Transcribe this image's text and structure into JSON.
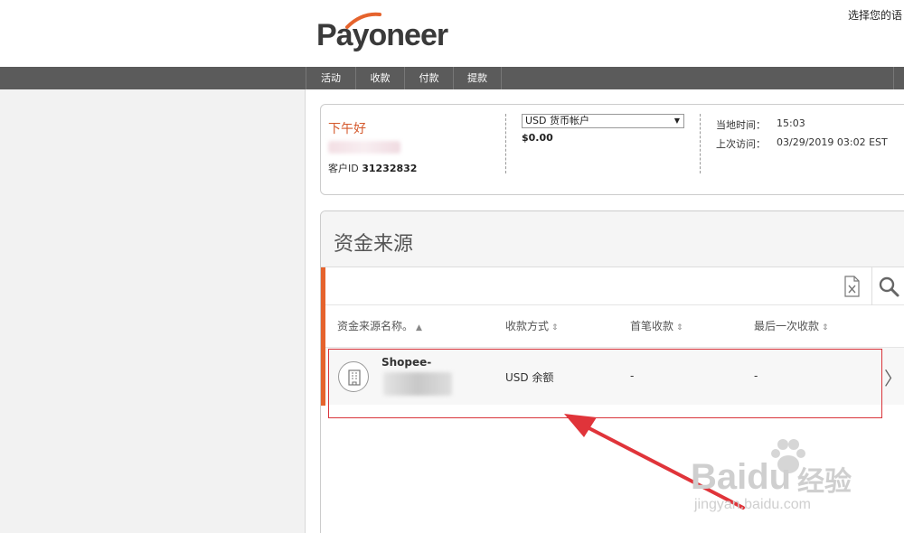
{
  "brand": {
    "logo_text": "Payoneer",
    "logo_accent": "#e5632d"
  },
  "header": {
    "language_link": "选择您的语"
  },
  "nav": {
    "items": [
      {
        "label": "活动"
      },
      {
        "label": "收款"
      },
      {
        "label": "付款"
      },
      {
        "label": "提款"
      }
    ]
  },
  "summary": {
    "greeting": "下午好",
    "customer_id_label": "客户ID",
    "customer_id": "31232832",
    "account_select": "USD 货币帐户",
    "balance": "$0.00",
    "local_time_label": "当地时间：",
    "local_time": "15:03",
    "last_visit_label": "上次访问：",
    "last_visit": "03/29/2019 03:02 EST"
  },
  "funding": {
    "title": "资金来源",
    "columns": [
      "资金来源名称。",
      "收款方式",
      "首笔收款",
      "最后一次收款"
    ],
    "rows": [
      {
        "name": "Shopee-",
        "method": "USD 余额",
        "first": "-",
        "last": "-"
      }
    ]
  },
  "watermark": {
    "brand": "Baidu",
    "suffix": "经验",
    "url": "jingyan.baidu.com"
  },
  "colors": {
    "accent": "#e5632d",
    "nav_bg": "#5b5b5b",
    "annotation_red": "#d9343a"
  }
}
